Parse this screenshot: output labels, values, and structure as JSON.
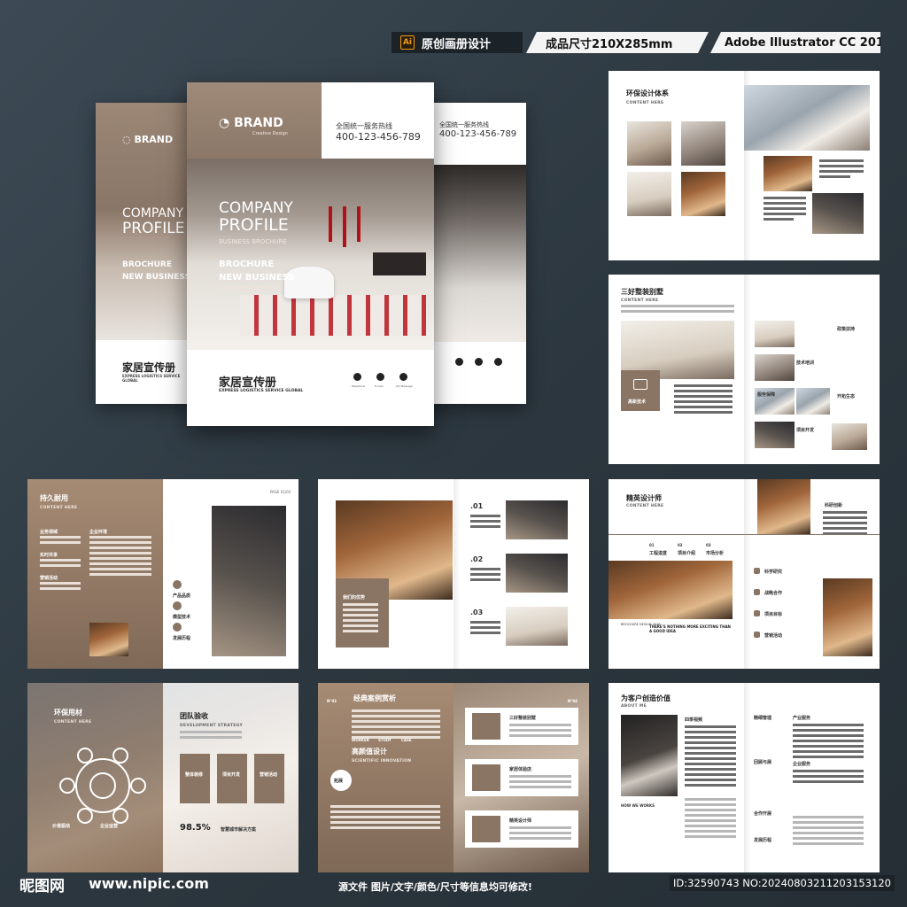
{
  "header": {
    "tag1": "原创画册设计",
    "tag2": "成品尺寸210X285mm",
    "tag3": "Adobe Illustrator CC 2018",
    "ai_icon": "Ai"
  },
  "cover": {
    "brand": "BRAND",
    "brand_sub": "Creative Design",
    "hotline_label": "全国统一服务热线",
    "hotline": "400-123-456-789",
    "title1": "COMPANY",
    "title2": "PROFILE",
    "subtitle": "BUSINESS BROCHURE",
    "line1": "BROCHURE",
    "line2": "NEW BUSINESS",
    "line3": "NEW BUSINESS BROCHURE",
    "cn_title": "家居宣传册",
    "en_sub": "EXPRESS LOGISTICS SERVICE GLOBAL",
    "icons": [
      {
        "icon": "phone-icon",
        "label": "Telephone"
      },
      {
        "icon": "mail-icon",
        "label": "E-mail"
      },
      {
        "icon": "chat-icon",
        "label": "QQ Message"
      }
    ]
  },
  "s1": {
    "title": "环保设计体系",
    "sub": "CONTENT HERE"
  },
  "s2": {
    "title": "三好整装别墅",
    "sub": "CONTENT HERE",
    "badge": "高新技术",
    "items": [
      "政策扶持",
      "技术培训",
      "服务保障",
      "开拓生态",
      "项目开发"
    ]
  },
  "s3": {
    "title": "持久耐用",
    "sub": "CONTENT HERE",
    "page": "PAGE 01/02",
    "labels": [
      "业务领域",
      "企业环境",
      "实时共享",
      "营销活动"
    ],
    "list": [
      "产品品质",
      "模型技术",
      "发展历程"
    ]
  },
  "s4": {
    "caption": "我们的优势",
    "nums": [
      ".01",
      ".02",
      ".03"
    ]
  },
  "s5": {
    "title": "精英设计师",
    "sub": "CONTENT HERE",
    "side": "科研创新",
    "steps": [
      {
        "n": "01",
        "t": "工程进度"
      },
      {
        "n": "02",
        "t": "项目介绍"
      },
      {
        "n": "03",
        "t": "市场分析"
      }
    ],
    "list": [
      "科学研究",
      "战略合作",
      "项目目标",
      "营销活动"
    ],
    "caption": "THERE'S NOTHING MORE EXCITING THAN A GOOD IDEA",
    "brochure": "BROCHURE DESIGN 2018"
  },
  "s6": {
    "title": "环保用材",
    "sub": "CONTENT HERE",
    "cap1": "价值驱动",
    "cap2": "企业运营",
    "right_title": "团队验收",
    "right_sub": "DEVELOPMENT STRATEGY",
    "cards": [
      "整体装修",
      "项目开发",
      "营销活动"
    ],
    "pct": "98.5%",
    "pct_label": "智慧城市解决方案"
  },
  "s7": {
    "no1": "N°03",
    "no2": "N°04",
    "title": "经典案例赏析",
    "tags": [
      "WORKER",
      "STUDY",
      "CASE"
    ],
    "cn": "高颜值设计",
    "en": "SCIENTIFIC INNOVATION",
    "small": "拓展",
    "cases": [
      "三好整装别墅",
      "家居体验店",
      "精英设计师"
    ]
  },
  "s8": {
    "title": "为客户创造价值",
    "sub": "ABOUT ME",
    "now": "HOW WE WORKS",
    "cols": [
      "四季视频",
      "精细管理",
      "产业服务"
    ],
    "rows": [
      "企业服务",
      "合作开展",
      "回顾与展",
      "发展历程"
    ]
  },
  "footer": {
    "logo": "昵图网",
    "url": "www.nipic.com",
    "note": "源文件 图片/文字/颜色/尺寸等信息均可修改!",
    "id": "ID:32590743 NO:20240803211203153120"
  }
}
